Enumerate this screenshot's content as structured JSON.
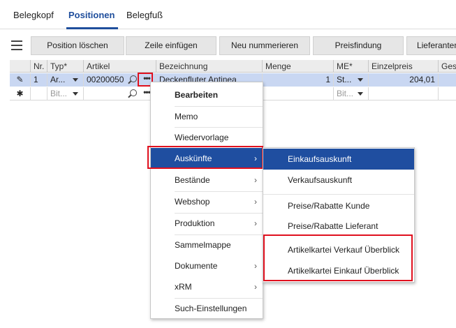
{
  "tabs": [
    "Belegkopf",
    "Positionen",
    "Belegfuß"
  ],
  "toolbar": {
    "buttons": [
      "Position löschen",
      "Zeile einfügen",
      "Neu nummerieren",
      "Preisfindung",
      "Lieferanten"
    ]
  },
  "grid": {
    "headers": [
      "Nr.",
      "Typ*",
      "Artikel",
      "Bezeichnung",
      "Menge",
      "ME*",
      "Einzelpreis",
      "Ges"
    ],
    "row1": {
      "nr": "1",
      "typ": "Ar...",
      "artikel": "00200050",
      "dots": "•••",
      "bezeichnung": "Deckenfluter Antinea",
      "menge": "1",
      "me": "St...",
      "einzelpreis": "204,01"
    },
    "row2": {
      "marker": "✱",
      "typ_placeholder": "Bit...",
      "dots": "•••",
      "me_placeholder": "Bit..."
    }
  },
  "context_menu": {
    "items": [
      "Bearbeiten",
      "Memo",
      "Wiedervorlage",
      "Auskünfte",
      "Bestände",
      "Webshop",
      "Produktion",
      "Sammelmappe",
      "Dokumente",
      "xRM",
      "Such-Einstellungen"
    ],
    "chevron": "›"
  },
  "submenu": {
    "items": [
      "Einkaufsauskunft",
      "Verkaufsauskunft",
      "Preise/Rabatte Kunde",
      "Preise/Rabatte Lieferant",
      "Artikelkartei Verkauf Überblick",
      "Artikelkartei Einkauf Überblick"
    ]
  },
  "colors": {
    "accent": "#1f4e9c",
    "highlight": "#1f4ea0",
    "selected_row": "#c9d7f2",
    "annotation_red": "#e0101e"
  }
}
